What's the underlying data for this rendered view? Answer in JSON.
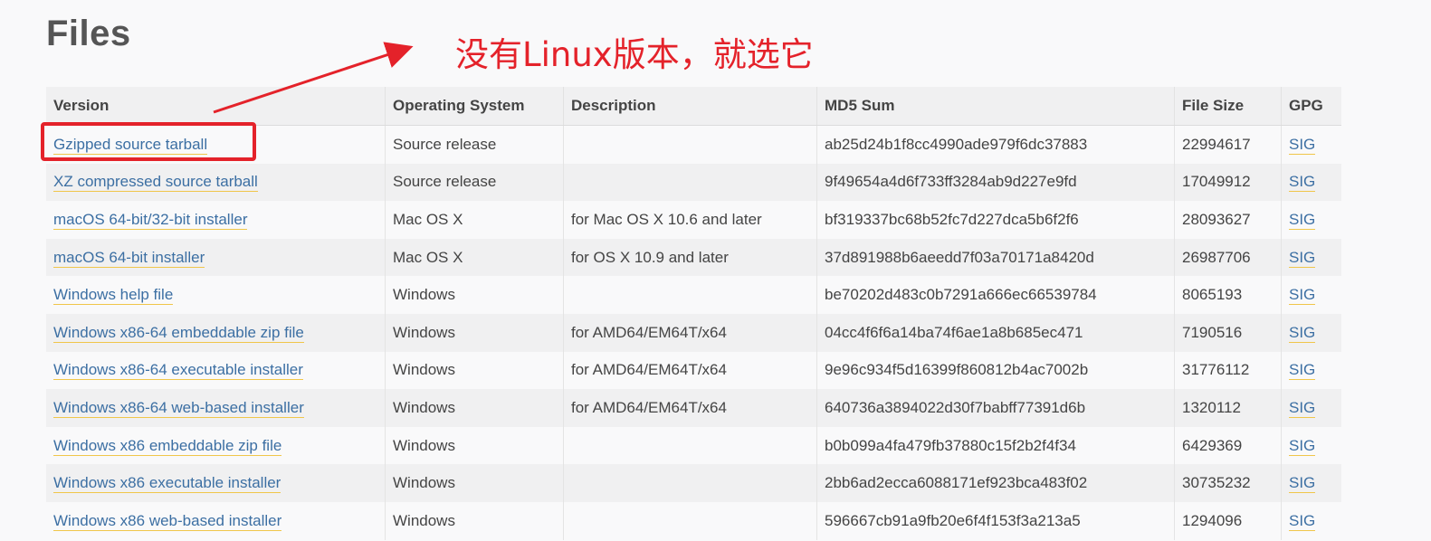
{
  "page": {
    "title": "Files"
  },
  "annotation": {
    "text": "没有Linux版本，就选它",
    "color": "#e4222a"
  },
  "table": {
    "headers": [
      "Version",
      "Operating System",
      "Description",
      "MD5 Sum",
      "File Size",
      "GPG"
    ],
    "rows": [
      {
        "version": "Gzipped source tarball",
        "os": "Source release",
        "description": "",
        "md5": "ab25d24b1f8cc4990ade979f6dc37883",
        "size": "22994617",
        "gpg": "SIG"
      },
      {
        "version": "XZ compressed source tarball",
        "os": "Source release",
        "description": "",
        "md5": "9f49654a4d6f733ff3284ab9d227e9fd",
        "size": "17049912",
        "gpg": "SIG"
      },
      {
        "version": "macOS 64-bit/32-bit installer",
        "os": "Mac OS X",
        "description": "for Mac OS X 10.6 and later",
        "md5": "bf319337bc68b52fc7d227dca5b6f2f6",
        "size": "28093627",
        "gpg": "SIG"
      },
      {
        "version": "macOS 64-bit installer",
        "os": "Mac OS X",
        "description": "for OS X 10.9 and later",
        "md5": "37d891988b6aeedd7f03a70171a8420d",
        "size": "26987706",
        "gpg": "SIG"
      },
      {
        "version": "Windows help file",
        "os": "Windows",
        "description": "",
        "md5": "be70202d483c0b7291a666ec66539784",
        "size": "8065193",
        "gpg": "SIG"
      },
      {
        "version": "Windows x86-64 embeddable zip file",
        "os": "Windows",
        "description": "for AMD64/EM64T/x64",
        "md5": "04cc4f6f6a14ba74f6ae1a8b685ec471",
        "size": "7190516",
        "gpg": "SIG"
      },
      {
        "version": "Windows x86-64 executable installer",
        "os": "Windows",
        "description": "for AMD64/EM64T/x64",
        "md5": "9e96c934f5d16399f860812b4ac7002b",
        "size": "31776112",
        "gpg": "SIG"
      },
      {
        "version": "Windows x86-64 web-based installer",
        "os": "Windows",
        "description": "for AMD64/EM64T/x64",
        "md5": "640736a3894022d30f7babff77391d6b",
        "size": "1320112",
        "gpg": "SIG"
      },
      {
        "version": "Windows x86 embeddable zip file",
        "os": "Windows",
        "description": "",
        "md5": "b0b099a4fa479fb37880c15f2b2f4f34",
        "size": "6429369",
        "gpg": "SIG"
      },
      {
        "version": "Windows x86 executable installer",
        "os": "Windows",
        "description": "",
        "md5": "2bb6ad2ecca6088171ef923bca483f02",
        "size": "30735232",
        "gpg": "SIG"
      },
      {
        "version": "Windows x86 web-based installer",
        "os": "Windows",
        "description": "",
        "md5": "596667cb91a9fb20e6f4f153f3a213a5",
        "size": "1294096",
        "gpg": "SIG"
      }
    ]
  }
}
